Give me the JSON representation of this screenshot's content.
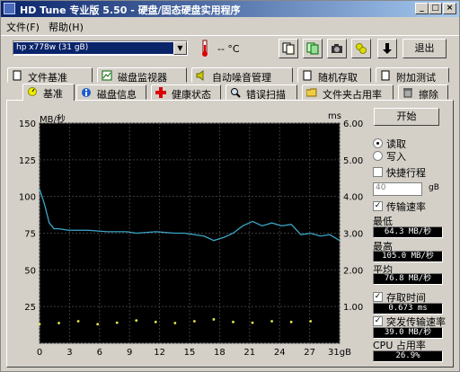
{
  "window": {
    "title": "HD Tune 专业版 5.50 - 硬盘/固态硬盘实用程序"
  },
  "menu": [
    "文件(F)",
    "帮助(H)"
  ],
  "toolbar": {
    "drive": "hp        x778w (31 gB)",
    "temperature": "-- °C",
    "exit_label": "退出",
    "icons": [
      "copy-icon",
      "copy-all-icon",
      "screenshot-icon",
      "options-icon",
      "save-icon"
    ]
  },
  "tabs_row1": [
    "文件基准",
    "磁盘监视器",
    "自动噪音管理",
    "随机存取",
    "附加测试"
  ],
  "tabs_row2": [
    "基准",
    "磁盘信息",
    "健康状态",
    "错误扫描",
    "文件夹占用率",
    "擦除"
  ],
  "active_tab": "基准",
  "controls": {
    "start_label": "开始",
    "read_label": "读取",
    "write_label": "写入",
    "short_stroke_label": "快捷行程",
    "short_stroke_value": "40",
    "short_stroke_unit": "gB",
    "transfer_rate_label": "传输速率",
    "min_label": "最低",
    "min_value": "64.3 MB/秒",
    "max_label": "最高",
    "max_value": "105.0 MB/秒",
    "avg_label": "平均",
    "avg_value": "76.8 MB/秒",
    "access_time_label": "存取时间",
    "access_time_value": "0.673 ms",
    "burst_label": "突发传输速率",
    "burst_value": "39.0 MB/秒",
    "cpu_label": "CPU 占用率",
    "cpu_value": "26.9%"
  },
  "chart_data": {
    "type": "line",
    "y_left_label": "MB/秒",
    "y_right_label": "ms",
    "y_left_ticks": [
      "150",
      "125",
      "100",
      "75",
      "50",
      "25"
    ],
    "y_right_ticks": [
      "6.00",
      "5.00",
      "4.00",
      "3.00",
      "2.00",
      "1.00"
    ],
    "x_ticks": [
      "0",
      "3",
      "6",
      "9",
      "12",
      "15",
      "18",
      "21",
      "24",
      "27",
      "31gB"
    ],
    "xlim": [
      0,
      31
    ],
    "ylim_left": [
      0,
      150
    ],
    "ylim_right": [
      0,
      6
    ],
    "grid": true,
    "series": [
      {
        "color": "#3ba7c9",
        "x": [
          0,
          0.5,
          1,
          1.5,
          2,
          3,
          5,
          7,
          9,
          10,
          12,
          14,
          15,
          17,
          18,
          19,
          20,
          21,
          22,
          23,
          24,
          25,
          26,
          27,
          28,
          29,
          30,
          31
        ],
        "values": [
          105,
          95,
          82,
          78,
          78,
          77,
          77,
          76,
          76,
          75,
          76,
          75,
          75,
          73,
          70,
          72,
          75,
          80,
          83,
          80,
          82,
          80,
          81,
          74,
          75,
          73,
          74,
          70
        ]
      },
      {
        "color": "#e8e84a",
        "x": [
          0,
          2,
          4,
          6,
          8,
          10,
          12,
          14,
          16,
          18,
          20,
          22,
          24,
          26,
          28
        ],
        "values": [
          0.52,
          0.55,
          0.6,
          0.52,
          0.56,
          0.62,
          0.58,
          0.55,
          0.6,
          0.65,
          0.58,
          0.56,
          0.6,
          0.58,
          0.6
        ]
      }
    ]
  }
}
